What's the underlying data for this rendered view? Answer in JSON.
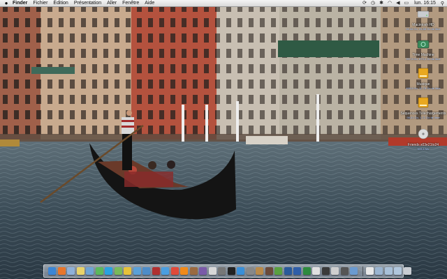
{
  "menubar": {
    "app_name": "Finder",
    "items": [
      "Fichier",
      "Édition",
      "Présentation",
      "Aller",
      "Fenêtre",
      "Aide"
    ],
    "time": "lun. 16:15",
    "status_icons": [
      "sync-icon",
      "clock-icon",
      "bluetooth-icon",
      "wifi-icon",
      "volume-icon",
      "battery-icon"
    ]
  },
  "desktop": {
    "icons": [
      {
        "name": "Macintosh HD",
        "info": "55,44 Go, 24,88 Go de libre",
        "icon": "hard-drive-icon"
      },
      {
        "name": "Time Machine",
        "info": "997,9 Go, 673,4 Go de libre",
        "icon": "time-machine-drive-icon"
      },
      {
        "name": "Musique",
        "info": "499,9 Go, 12,78 Go de libre",
        "icon": "external-drive-icon"
      },
      {
        "name": "Séquences Téléchargements",
        "info": "98,01 Go, 1,72 Go de libre",
        "icon": "external-drive-icon"
      },
      {
        "name": "Friends s03e21to24",
        "info": "533,6 Mo",
        "icon": "disc-image-icon"
      }
    ]
  },
  "dock": {
    "apps": [
      {
        "name": "finder-icon",
        "color": "#3b86d6"
      },
      {
        "name": "firefox-icon",
        "color": "#e8762b"
      },
      {
        "name": "mail-icon",
        "color": "#8fb0d8"
      },
      {
        "name": "stickies-icon",
        "color": "#e9d36a"
      },
      {
        "name": "preview-icon",
        "color": "#6ea4d4"
      },
      {
        "name": "messages-icon",
        "color": "#5cb85c"
      },
      {
        "name": "skype-icon",
        "color": "#2aa2e0"
      },
      {
        "name": "ichat-icon",
        "color": "#7ab95a"
      },
      {
        "name": "adium-icon",
        "color": "#e6c13a"
      },
      {
        "name": "itunes-icon",
        "color": "#5aa0d8"
      },
      {
        "name": "iphoto-icon",
        "color": "#4d8cc8"
      },
      {
        "name": "photo-booth-icon",
        "color": "#b03030"
      },
      {
        "name": "app-store-icon",
        "color": "#4a9ee0"
      },
      {
        "name": "ical-icon",
        "color": "#e04a3a"
      },
      {
        "name": "vlc-icon",
        "color": "#f08a1a"
      },
      {
        "name": "garageband-icon",
        "color": "#9a6a40"
      },
      {
        "name": "imovie-icon",
        "color": "#7a5aa8"
      },
      {
        "name": "textedit-icon",
        "color": "#d8d8d8"
      },
      {
        "name": "calculator-icon",
        "color": "#777777"
      },
      {
        "name": "terminal-icon",
        "color": "#222222"
      },
      {
        "name": "safari-icon",
        "color": "#3a8fd8"
      },
      {
        "name": "system-preferences-icon",
        "color": "#888888"
      },
      {
        "name": "address-book-icon",
        "color": "#b88a4a"
      },
      {
        "name": "dictionary-icon",
        "color": "#6a4a3a"
      },
      {
        "name": "utorrent-icon",
        "color": "#5aa040"
      },
      {
        "name": "photoshop-icon",
        "color": "#2a5a9a"
      },
      {
        "name": "word-icon",
        "color": "#2f5ea8"
      },
      {
        "name": "excel-icon",
        "color": "#2e8a3e"
      },
      {
        "name": "preview2-icon",
        "color": "#e0e0e0"
      },
      {
        "name": "activity-monitor-icon",
        "color": "#3a3a3a"
      },
      {
        "name": "font-book-icon",
        "color": "#cfcfcf"
      },
      {
        "name": "console-icon",
        "color": "#555555"
      },
      {
        "name": "itunes2-icon",
        "color": "#6a9ad0"
      }
    ],
    "docs": [
      {
        "name": "document-icon",
        "color": "#e8e8e8"
      },
      {
        "name": "applications-stack-icon",
        "color": "#9ab4d0"
      },
      {
        "name": "downloads-stack-icon",
        "color": "#a8c0d8"
      },
      {
        "name": "documents-stack-icon",
        "color": "#b0c6dc"
      },
      {
        "name": "trash-icon",
        "color": "#c8ccd2"
      }
    ]
  }
}
